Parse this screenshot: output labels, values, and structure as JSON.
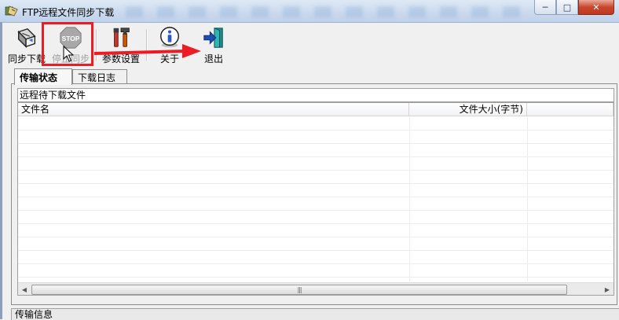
{
  "window": {
    "title": "FTP远程文件同步下载",
    "minimize_glyph": "─",
    "maximize_glyph": "□",
    "close_glyph": "✕"
  },
  "toolbar": {
    "items": [
      {
        "label": "同步下载",
        "icon": "sync-download-icon",
        "enabled": true
      },
      {
        "label": "停止同步",
        "icon": "stop-icon",
        "enabled": false,
        "highlighted": true
      },
      {
        "label": "参数设置",
        "icon": "tools-icon",
        "enabled": true
      },
      {
        "label": "关于",
        "icon": "info-icon",
        "enabled": true
      },
      {
        "label": "退出",
        "icon": "exit-door-icon",
        "enabled": true
      }
    ],
    "stop_icon_text": "STOP"
  },
  "tabs": [
    {
      "label": "传输状态",
      "active": true
    },
    {
      "label": "下载日志",
      "active": false
    }
  ],
  "remote_panel": {
    "title": "远程待下载文件",
    "columns": [
      "文件名",
      "文件大小(字节)",
      ""
    ],
    "rows": []
  },
  "scrollbar": {
    "grip": "|||"
  },
  "bottom_panel": {
    "title": "传输信息"
  },
  "colors": {
    "highlight": "#ec1c24",
    "titlebar": "#c9d9ee",
    "close_button": "#c9462d"
  }
}
